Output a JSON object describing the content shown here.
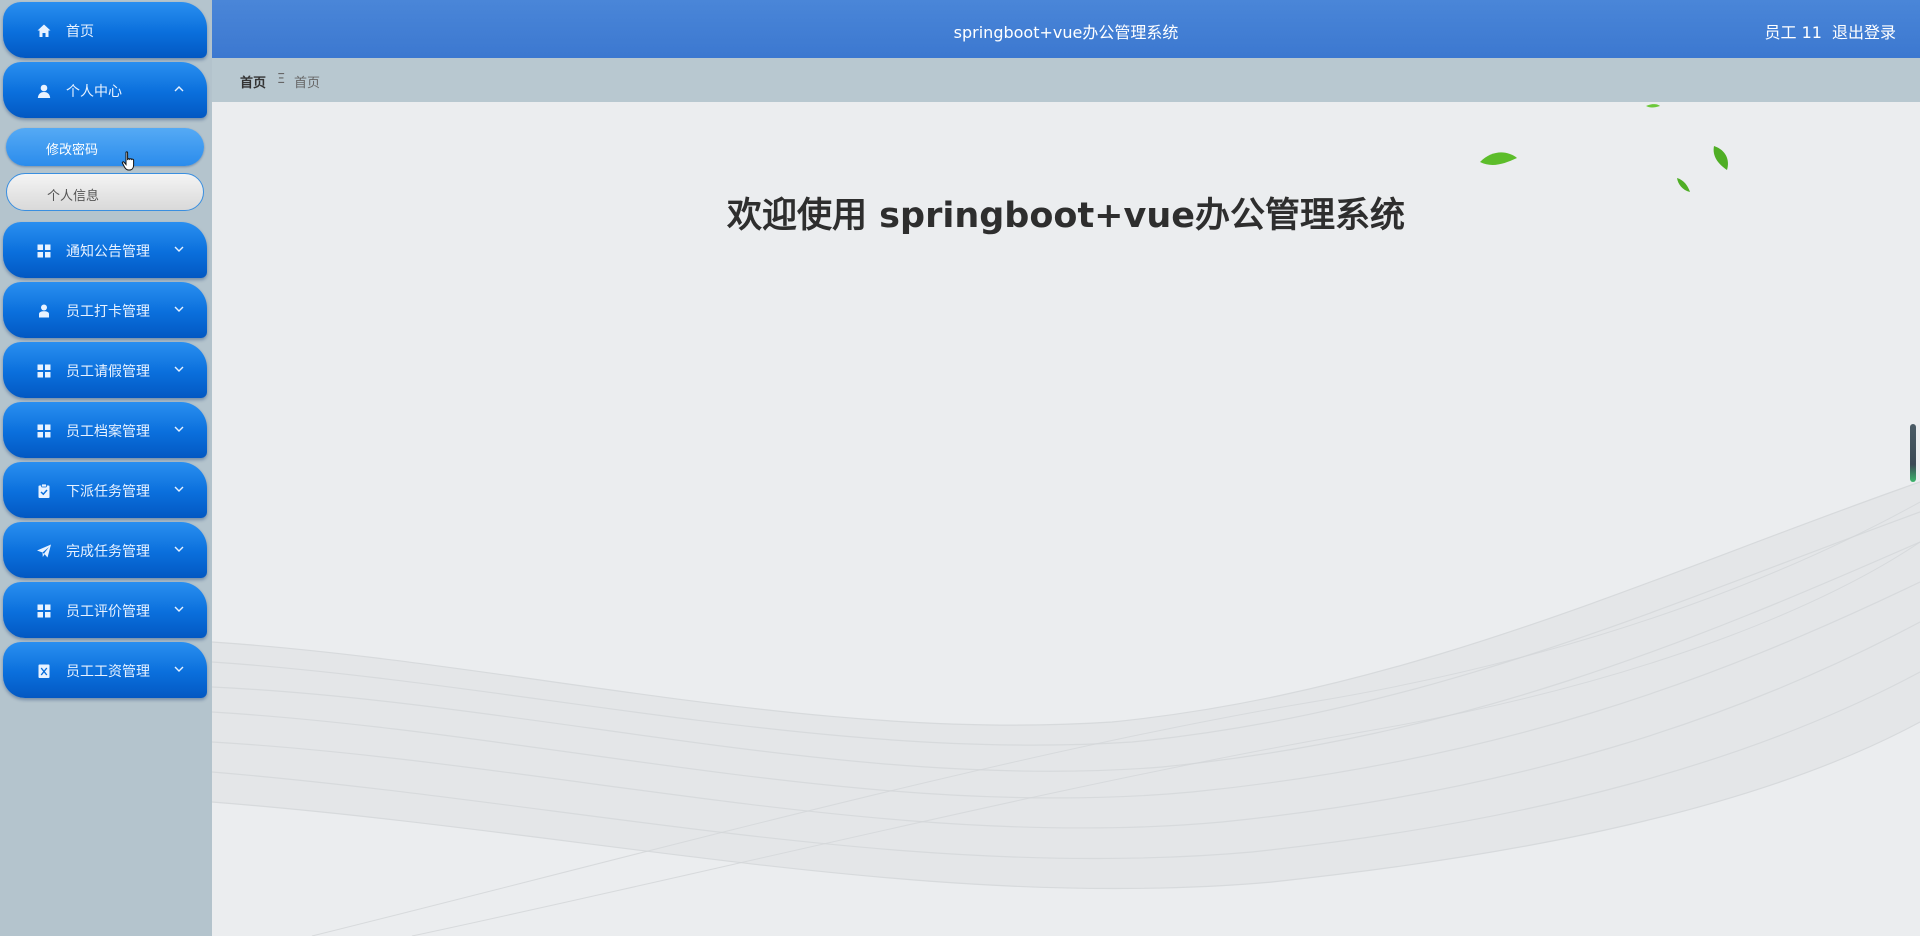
{
  "sidebar": {
    "items": [
      {
        "label": "首页",
        "icon": "home-icon"
      },
      {
        "label": "个人中心",
        "icon": "user-icon",
        "expanded": true,
        "children": [
          {
            "label": "修改密码",
            "active": true
          },
          {
            "label": "个人信息",
            "active": false
          }
        ]
      },
      {
        "label": "通知公告管理",
        "icon": "grid-icon"
      },
      {
        "label": "员工打卡管理",
        "icon": "person-icon"
      },
      {
        "label": "员工请假管理",
        "icon": "grid-icon"
      },
      {
        "label": "员工档案管理",
        "icon": "grid-icon"
      },
      {
        "label": "下派任务管理",
        "icon": "clipboard-icon"
      },
      {
        "label": "完成任务管理",
        "icon": "send-icon"
      },
      {
        "label": "员工评价管理",
        "icon": "grid-icon"
      },
      {
        "label": "员工工资管理",
        "icon": "receipt-icon"
      }
    ]
  },
  "header": {
    "title": "springboot+vue办公管理系统",
    "user": "员工 11",
    "logout": "退出登录"
  },
  "breadcrumb": {
    "home": "首页",
    "separator": "Ξ",
    "current": "首页"
  },
  "main": {
    "welcome": "欢迎使用 springboot+vue办公管理系统"
  },
  "colors": {
    "menu_blue": "#0a6fdc",
    "header_blue": "#3c78d0",
    "sidebar_bg": "#b4c4cd",
    "content_bg": "#ebedef",
    "leaf_green": "#5cbd2a"
  }
}
